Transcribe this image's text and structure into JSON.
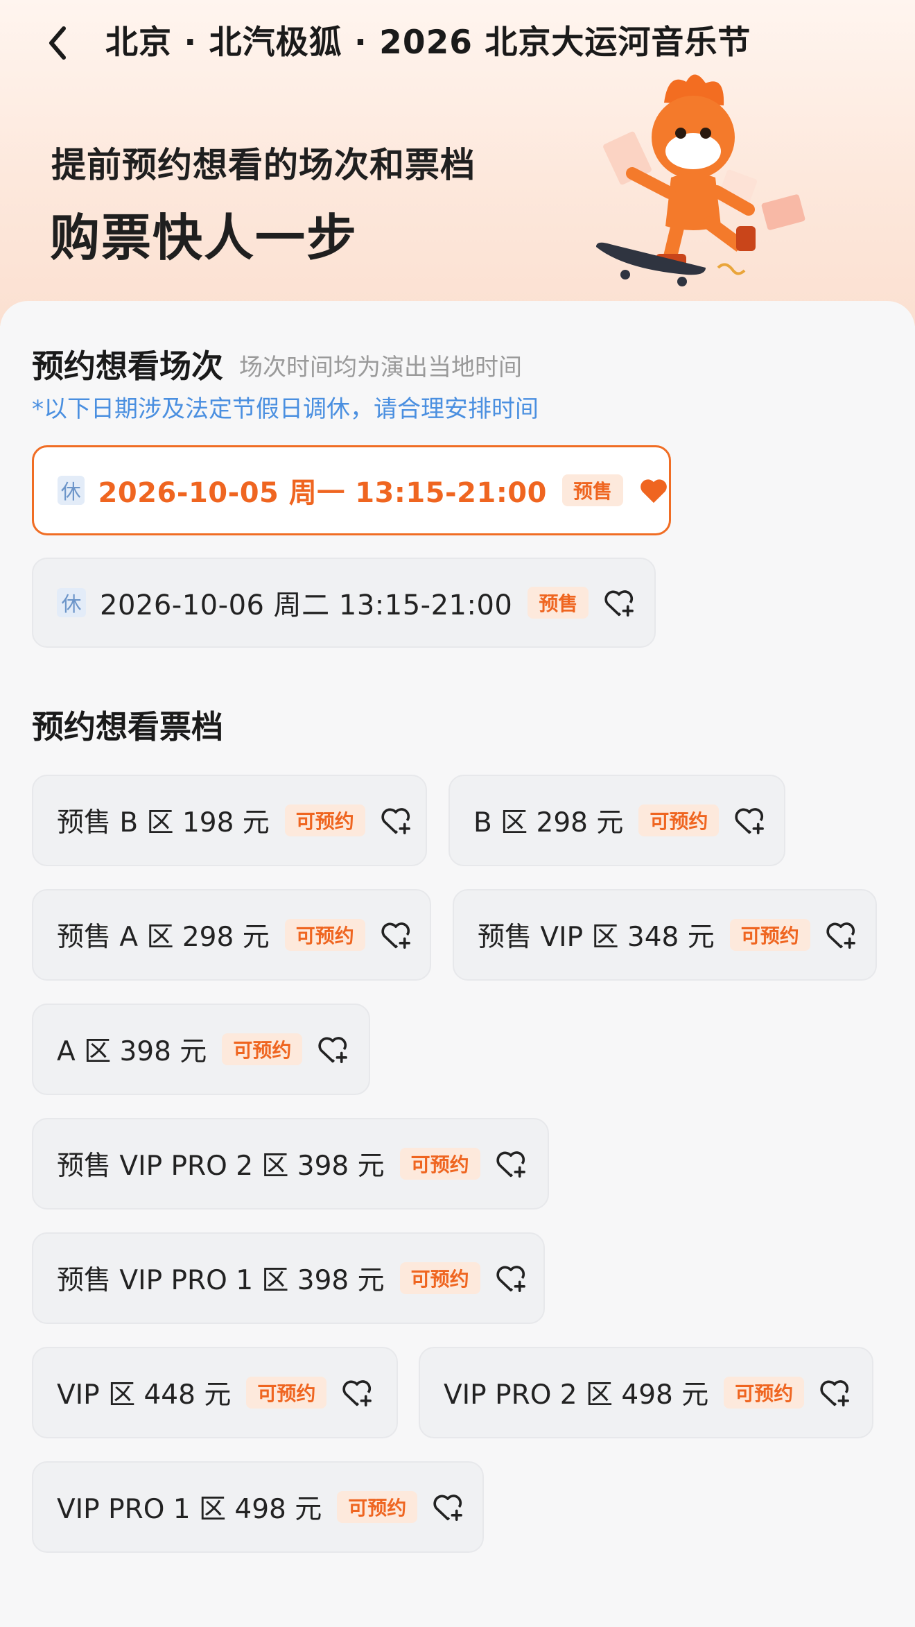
{
  "header": {
    "back_icon": "chevron-left-icon",
    "title": "北京 · 北汽极狐 · 2026 北京大运河音乐节"
  },
  "banner": {
    "line1": "提前预约想看的场次和票档",
    "line2": "购票快人一步",
    "mascot": "fox-mascot-skateboard"
  },
  "sessions_section": {
    "title": "预约想看场次",
    "subtitle": "场次时间均为演出当地时间",
    "note": "*以下日期涉及法定节假日调休，请合理安排时间",
    "items": [
      {
        "rest_tag": "休",
        "text": "2026-10-05  周一 13:15-21:00",
        "badge": "预售",
        "selected": true,
        "heart_icon": "heart-filled-icon"
      },
      {
        "rest_tag": "休",
        "text": "2026-10-06  周二 13:15-21:00",
        "badge": "预售",
        "selected": false,
        "heart_icon": "heart-plus-icon"
      }
    ]
  },
  "tiers_section": {
    "title": "预约想看票档",
    "items": [
      {
        "label": "预售 B 区 198 元",
        "badge": "可预约"
      },
      {
        "label": "B 区 298 元",
        "badge": "可预约"
      },
      {
        "label": "预售 A 区 298 元",
        "badge": "可预约"
      },
      {
        "label": "预售 VIP 区 348 元",
        "badge": "可预约"
      },
      {
        "label": "A 区 398 元",
        "badge": "可预约"
      },
      {
        "label": "预售 VIP PRO 2 区 398 元",
        "badge": "可预约"
      },
      {
        "label": "预售 VIP PRO 1 区 398 元",
        "badge": "可预约"
      },
      {
        "label": "VIP 区 448 元",
        "badge": "可预约"
      },
      {
        "label": "VIP PRO 2 区 498 元",
        "badge": "可预约"
      },
      {
        "label": "VIP PRO 1 区 498 元",
        "badge": "可预约"
      }
    ]
  },
  "colors": {
    "accent": "#ef6520",
    "badge_bg": "#fde9dc",
    "note_blue": "#4a8fe0",
    "card_bg": "#f0f1f3"
  }
}
